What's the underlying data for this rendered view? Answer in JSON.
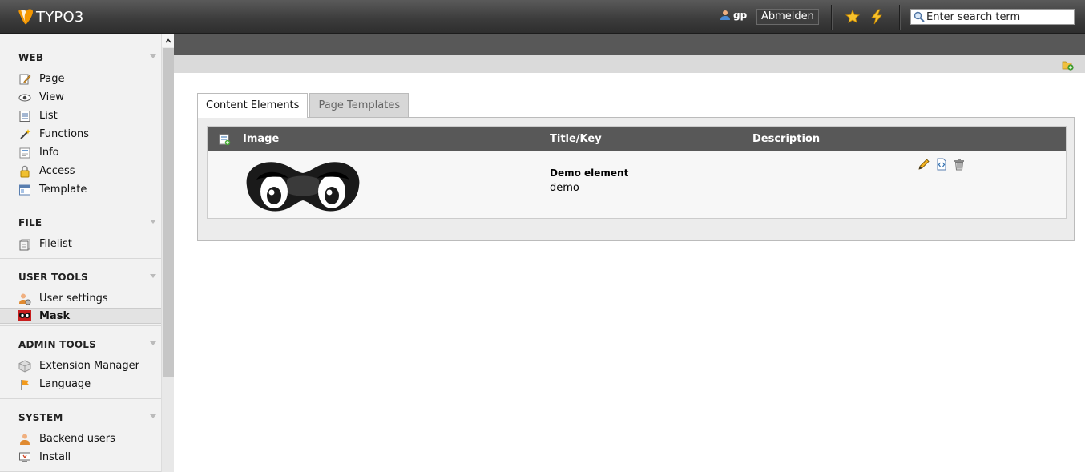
{
  "app": {
    "logo_text": "TYPO3"
  },
  "topbar": {
    "username": "gp",
    "logout_label": "Abmelden",
    "search_placeholder": "Enter search term"
  },
  "sidebar": {
    "groups": [
      {
        "title": "WEB",
        "items": [
          {
            "label": "Page",
            "icon": "page-edit-icon"
          },
          {
            "label": "View",
            "icon": "eye-icon"
          },
          {
            "label": "List",
            "icon": "list-icon"
          },
          {
            "label": "Functions",
            "icon": "wand-icon"
          },
          {
            "label": "Info",
            "icon": "info-icon"
          },
          {
            "label": "Access",
            "icon": "lock-icon"
          },
          {
            "label": "Template",
            "icon": "template-icon"
          }
        ]
      },
      {
        "title": "FILE",
        "items": [
          {
            "label": "Filelist",
            "icon": "filelist-icon"
          }
        ]
      },
      {
        "title": "USER TOOLS",
        "items": [
          {
            "label": "User settings",
            "icon": "user-settings-icon"
          },
          {
            "label": "Mask",
            "icon": "mask-icon",
            "active": true
          }
        ]
      },
      {
        "title": "ADMIN TOOLS",
        "items": [
          {
            "label": "Extension Manager",
            "icon": "extension-icon"
          },
          {
            "label": "Language",
            "icon": "language-icon"
          }
        ]
      },
      {
        "title": "SYSTEM",
        "items": [
          {
            "label": "Backend users",
            "icon": "backend-users-icon"
          },
          {
            "label": "Install",
            "icon": "install-icon"
          }
        ]
      }
    ]
  },
  "tabs": [
    {
      "label": "Content Elements",
      "active": true
    },
    {
      "label": "Page Templates",
      "active": false
    }
  ],
  "table": {
    "headers": {
      "image": "Image",
      "title_key": "Title/Key",
      "description": "Description"
    },
    "rows": [
      {
        "title": "Demo element",
        "key": "demo",
        "description": ""
      }
    ]
  },
  "colors": {
    "topbar": "#3b3b3b",
    "logo_orange": "#f49700",
    "header_gray": "#585858",
    "panel": "#ececec"
  }
}
